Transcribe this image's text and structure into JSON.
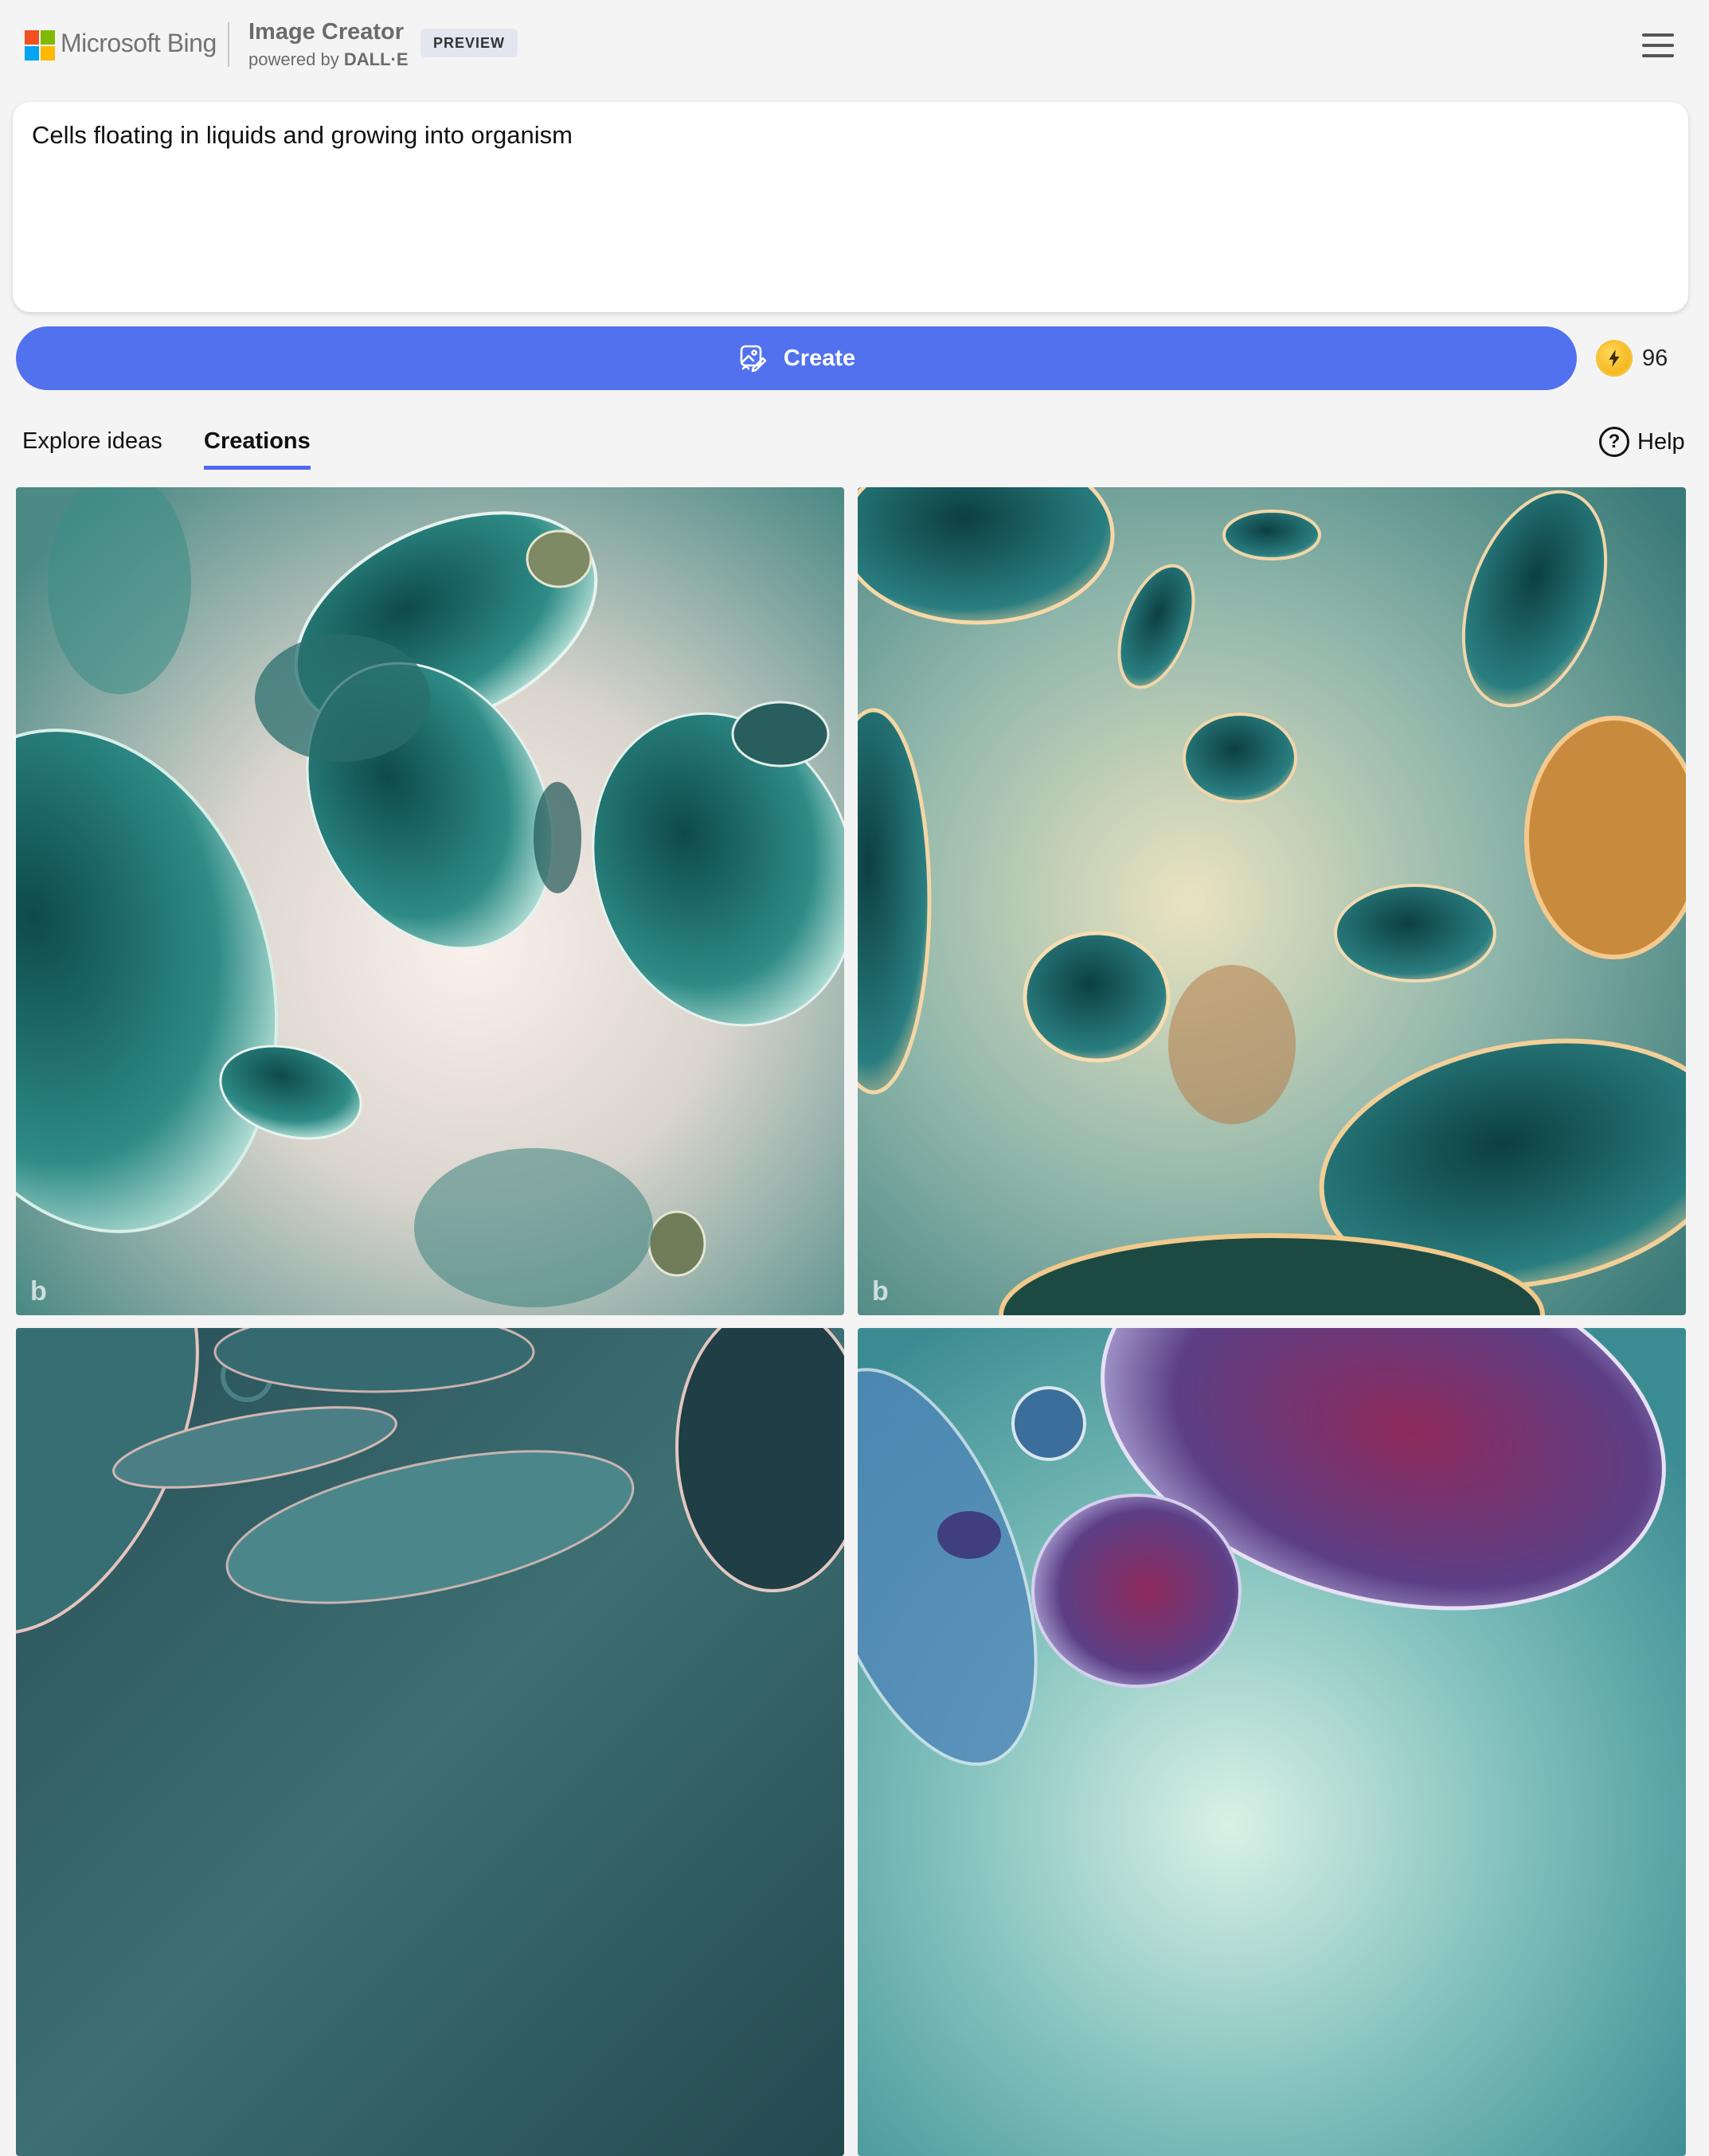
{
  "header": {
    "brand": "Microsoft Bing",
    "product_title": "Image Creator",
    "product_sub_prefix": "powered by ",
    "product_sub_strong": "DALL·E",
    "badge": "PREVIEW",
    "logo_colors": [
      "#f25022",
      "#7fba00",
      "#00a4ef",
      "#ffb900"
    ]
  },
  "prompt": {
    "value": "Cells floating in liquids and growing into organism"
  },
  "create_button": {
    "label": "Create",
    "icon": "image-create-icon",
    "color": "#5271ee"
  },
  "boosts": {
    "count": "96",
    "icon": "lightning-coin-icon"
  },
  "tabs": {
    "explore": "Explore ideas",
    "creations": "Creations",
    "active": "Creations"
  },
  "help": {
    "label": "Help",
    "icon": "question-circle-icon"
  },
  "images": [
    {
      "watermark": "b",
      "palette": "teal-pink"
    },
    {
      "watermark": "b",
      "palette": "teal-gold"
    },
    {
      "watermark": "",
      "palette": "dark-teal"
    },
    {
      "watermark": "",
      "palette": "teal-purple"
    }
  ]
}
